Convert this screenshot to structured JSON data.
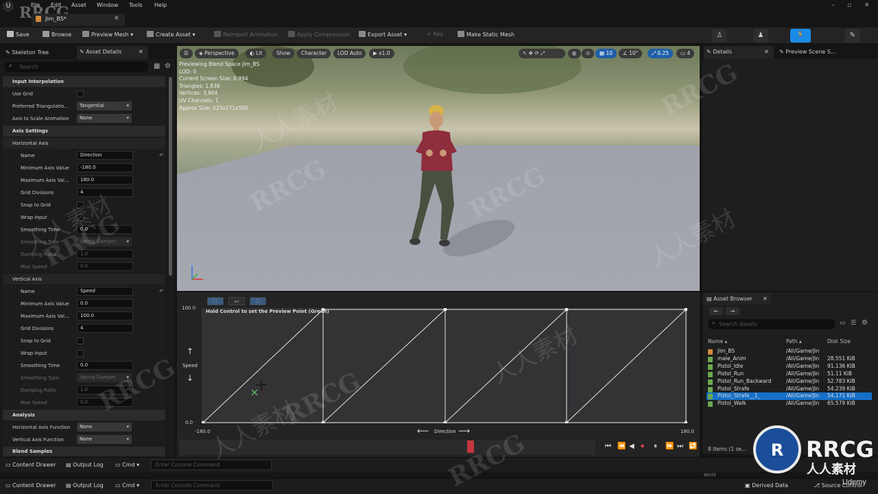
{
  "menu": {
    "app_logo": "U",
    "items": [
      "File",
      "Edit",
      "Asset",
      "Window",
      "Tools",
      "Help"
    ],
    "doc_tab": "Jim_BS*"
  },
  "watermark": {
    "top_left": "RRCG"
  },
  "toolbar": {
    "save": "Save",
    "browse": "Browse",
    "preview_mesh": "Preview Mesh",
    "create_asset": "Create Asset",
    "reimport_animation": "Reimport Animation",
    "apply_compression": "Apply Compression",
    "export_asset": "Export Asset",
    "key": "Key",
    "make_static_mesh": "Make Static Mesh"
  },
  "left_panel": {
    "tabs": [
      "Skeleton Tree",
      "Asset Details"
    ],
    "search_placeholder": "Search",
    "input_interpolation": {
      "header": "Input Interpolation",
      "use_grid": "Use Grid",
      "preferred_triangulation": "Preferred Triangulatio...",
      "preferred_triangulation_value": "Tangential",
      "axis_to_scale": "Axis to Scale Animation",
      "axis_to_scale_value": "None"
    },
    "axis_settings_header": "Axis Settings",
    "horizontal_axis": {
      "header": "Horizontal Axis",
      "name_label": "Name",
      "name_value": "Direction",
      "min_label": "Minimum Axis Value",
      "min_value": "-180.0",
      "max_label": "Maximum Axis Val...",
      "max_value": "180.0",
      "grid_label": "Grid Divisions",
      "grid_value": "4",
      "snap_label": "Snap to Grid",
      "wrap_label": "Wrap Input",
      "smoothing_time_label": "Smoothing Time",
      "smoothing_time_value": "0.0",
      "smoothing_type_label": "Smoothing Type",
      "smoothing_type_value": "Spring Damper",
      "damping_label": "Damping Ratio",
      "damping_value": "1.0",
      "max_speed_label": "Max Speed",
      "max_speed_value": "0.0"
    },
    "vertical_axis": {
      "header": "Vertical Axis",
      "name_label": "Name",
      "name_value": "Speed",
      "min_label": "Minimum Axis Value",
      "min_value": "0.0",
      "max_label": "Maximum Axis Val...",
      "max_value": "100.0",
      "grid_label": "Grid Divisions",
      "grid_value": "4",
      "snap_label": "Snap to Grid",
      "wrap_label": "Wrap Input",
      "smoothing_time_label": "Smoothing Time",
      "smoothing_time_value": "0.0",
      "smoothing_type_label": "Smoothing Type",
      "smoothing_type_value": "Spring Damper",
      "damping_label": "Damping Ratio",
      "damping_value": "1.0",
      "max_speed_label": "Max Speed",
      "max_speed_value": "0.0"
    },
    "analysis": {
      "header": "Analysis",
      "h_func_label": "Horizontal Axis Function",
      "h_func_value": "None",
      "v_func_label": "Vertical Axis Function",
      "v_func_value": "None"
    },
    "blend_samples_header": "Blend Samples"
  },
  "viewport": {
    "perspective": "Perspective",
    "lit": "Lit",
    "show": "Show",
    "character": "Character",
    "lod": "LOD Auto",
    "speed": "x1.0",
    "grid_snap": "10",
    "rot_snap": "10°",
    "scale_snap": "0.25",
    "cam_speed": "4",
    "stats": [
      "Previewing Blend Space Jim_BS",
      "LOD: 0",
      "Current Screen Size: 0.994",
      "Triangles: 1,836",
      "Vertices: 3,904",
      "UV Channels: 1",
      "Approx Size: 523x271x505"
    ]
  },
  "graph": {
    "hint": "Hold Control to set the Preview Point (Green)",
    "y_max": "100.0",
    "y_min": "0.0",
    "x_min": "-180.0",
    "x_max": "180.0",
    "y_label": "Speed",
    "x_label": "Direction"
  },
  "right_panel": {
    "details_tab": "Details",
    "preview_tab": "Preview Scene S...",
    "asset_browser_tab": "Asset Browser",
    "search_placeholder": "Search Assets",
    "col_name": "Name",
    "col_path": "Path",
    "col_size": "Disk Size",
    "assets": [
      {
        "name": "Jim_BS",
        "path": "/All/Game/Jin",
        "size": ""
      },
      {
        "name": "male_Anim",
        "path": "/All/Game/Jin",
        "size": "28.551 KiB"
      },
      {
        "name": "Pistol_Idle",
        "path": "/All/Game/Jin",
        "size": "91.136 KiB"
      },
      {
        "name": "Pistol_Run",
        "path": "/All/Game/Jin",
        "size": "51.11 KiB"
      },
      {
        "name": "Pistol_Run_Backward",
        "path": "/All/Game/Jin",
        "size": "52.783 KiB"
      },
      {
        "name": "Pistol_Strafe",
        "path": "/All/Game/Jin",
        "size": "54.239 KiB"
      },
      {
        "name": "Pistol_Strafe__1_",
        "path": "/All/Game/Jin",
        "size": "54.171 KiB"
      },
      {
        "name": "Pistol_Walk",
        "path": "/All/Game/Jin",
        "size": "65.579 KiB"
      }
    ],
    "items_count": "8 items (1 se..."
  },
  "bottom": {
    "content_drawer": "Content Drawer",
    "output_log": "Output Log",
    "cmd": "Cmd",
    "console_placeholder": "Enter Console Command",
    "derived_data": "Derived Data",
    "source_control": "Source Control",
    "world": "World",
    "udemy": "Udemy"
  },
  "logo": {
    "text": "RRCG",
    "sub": "人人素材"
  },
  "colors": {
    "accent": "#1a8ce8",
    "selection": "#1570c8",
    "panel": "#1a1a1a",
    "marker": "#c2373b"
  }
}
